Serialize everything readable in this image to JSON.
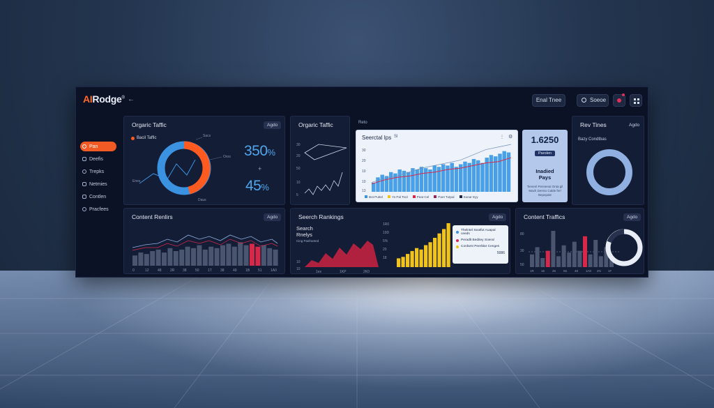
{
  "app": {
    "logo_ai": "AI",
    "logo_rest": "Rodge",
    "logo_mark": "®",
    "back_icon": "←",
    "top_button": "Enal Tnee",
    "search_button": "Soeoe"
  },
  "sidebar": {
    "items": [
      {
        "label": "Pan",
        "icon": "circle-icon",
        "active": true
      },
      {
        "label": "Deefis",
        "icon": "list-icon",
        "active": false
      },
      {
        "label": "Trepks",
        "icon": "refresh-icon",
        "active": false
      },
      {
        "label": "Netmies",
        "icon": "bell-icon",
        "active": false
      },
      {
        "label": "Contlen",
        "icon": "document-icon",
        "active": false
      },
      {
        "label": "Pracfees",
        "icon": "users-icon",
        "active": false
      }
    ]
  },
  "organic_traffic": {
    "title": "Orgaric Taffic",
    "chip": "Agdo",
    "legend": "Bacil Taffic",
    "donut_labels": [
      "Sacs",
      "Oros",
      "Enes",
      "Daus"
    ],
    "metric_1": "350",
    "metric_1_unit": "%",
    "metric_plus": "+",
    "metric_2": "45",
    "metric_2_unit": "%",
    "colors": {
      "orange": "#ff5a1f",
      "blue": "#3b92e0"
    }
  },
  "organic_traffic_2": {
    "title": "Orgaric Taffic",
    "y_ticks": [
      "30",
      "20",
      "50",
      "10",
      "5"
    ]
  },
  "search_tips": {
    "header": "Reto",
    "title": "Seerctal Ips",
    "mini": "Sl",
    "y_ticks": [
      "30",
      "20",
      "10",
      "10",
      "13"
    ],
    "legend": [
      "Bot Puttel",
      "Yo Pal Tool",
      "Peat Cel",
      "Pant Tutpal",
      "Soear Eyy"
    ]
  },
  "pays": {
    "value": "1.6250",
    "button": "Parolen",
    "label_1": "Inadied",
    "label_2": "Pays",
    "sub": "Tienenl Pennenai Onta gil Maxh Dernto Calde ferl Bepepale"
  },
  "rev_tines": {
    "title": "Rev Tines",
    "chip": "Agdo",
    "subtitle": "Bazy Condtbas"
  },
  "content_rankings": {
    "title": "Content Renlirs",
    "chip": "Agdo",
    "x_ticks": [
      "0",
      "12",
      "48",
      "2R",
      "38",
      "50",
      "1T",
      "38",
      "49",
      "1B",
      "51",
      "1A0"
    ]
  },
  "search_rankings": {
    "title": "Seerch Rankings",
    "subtitle_1": "Search",
    "subtitle_2": "Rnelys",
    "caption": "Cing Pasfranted",
    "chip": "Agdo",
    "y_ticks": [
      "1R0",
      "19D",
      "5%",
      "20",
      "18",
      "10",
      "10"
    ],
    "x_ticks": [
      "1es",
      "1KP",
      "2K0"
    ],
    "legend": [
      {
        "label": "Thelntel Seatfut Auapal ceeds",
        "color": "#3b92e0"
      },
      {
        "label": "Peradlt Beditey Soeral",
        "color": "#d8284a"
      },
      {
        "label": "Cordwnt Peerblar Cenges",
        "color": "#f2c31b"
      }
    ],
    "legend_value": "5086"
  },
  "content_traffics": {
    "title": "Content Traffics",
    "chip": "Agdo",
    "y_ticks": [
      "80",
      "30",
      "50"
    ],
    "x_ticks": [
      "1R",
      "16",
      "25",
      "56",
      "48",
      "1A0",
      "2N",
      "1F"
    ]
  },
  "chart_data": [
    {
      "type": "line",
      "title": "Seerctal Ips",
      "series": [
        {
          "name": "Bot Puttel",
          "values": [
            5,
            8,
            10,
            13,
            16,
            18,
            20,
            22,
            26,
            30,
            32,
            34
          ]
        },
        {
          "name": "Peat Cel",
          "values": [
            6,
            9,
            11,
            12,
            14,
            15,
            17,
            18,
            20,
            22,
            23,
            26
          ]
        }
      ]
    },
    {
      "type": "bar",
      "title": "Seerctal Ips",
      "values": [
        7,
        11,
        13,
        12,
        15,
        14,
        17,
        16,
        15,
        18,
        17,
        19,
        18,
        17,
        20,
        19,
        21,
        20,
        22,
        19,
        21,
        23,
        22,
        25,
        24,
        22,
        26,
        28,
        27,
        29,
        31,
        30
      ]
    },
    {
      "type": "bar",
      "title": "Seerch Rankings",
      "values": [
        12,
        14,
        18,
        22,
        26,
        24,
        30,
        34,
        40,
        46,
        52,
        60
      ]
    },
    {
      "type": "bar",
      "title": "Content Traffics",
      "values": [
        14,
        22,
        10,
        18,
        40,
        12,
        24,
        16,
        28,
        18,
        34,
        14,
        30,
        12,
        22,
        10
      ]
    }
  ]
}
